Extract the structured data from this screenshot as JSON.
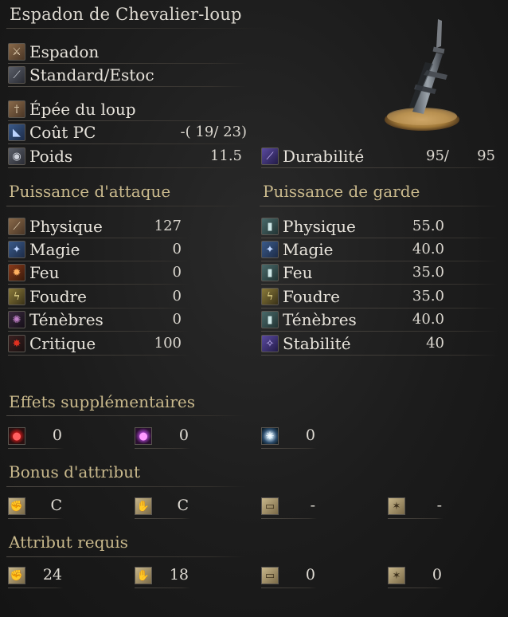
{
  "title": "Espadon de Chevalier-loup",
  "weapon": {
    "category": "Espadon",
    "attack_type": "Standard/Estoc",
    "skill": "Épée du loup",
    "fp_cost_label": "Coût PC",
    "fp_cost_value": "-( 19/ 23)",
    "weight_label": "Poids",
    "weight_value": "11.5",
    "durability_label": "Durabilité",
    "durability_current": "95/",
    "durability_max": "95"
  },
  "attack": {
    "heading": "Puissance d'attaque",
    "rows": [
      {
        "label": "Physique",
        "value": "127",
        "icon": "physical-icon"
      },
      {
        "label": "Magie",
        "value": "0",
        "icon": "magic-icon"
      },
      {
        "label": "Feu",
        "value": "0",
        "icon": "fire-icon"
      },
      {
        "label": "Foudre",
        "value": "0",
        "icon": "lightning-icon"
      },
      {
        "label": "Ténèbres",
        "value": "0",
        "icon": "dark-icon"
      },
      {
        "label": "Critique",
        "value": "100",
        "icon": "critical-icon"
      }
    ]
  },
  "guard": {
    "heading": "Puissance de garde",
    "rows": [
      {
        "label": "Physique",
        "value": "55.0",
        "icon": "physical-guard-icon"
      },
      {
        "label": "Magie",
        "value": "40.0",
        "icon": "magic-guard-icon"
      },
      {
        "label": "Feu",
        "value": "35.0",
        "icon": "fire-guard-icon"
      },
      {
        "label": "Foudre",
        "value": "35.0",
        "icon": "lightning-guard-icon"
      },
      {
        "label": "Ténèbres",
        "value": "40.0",
        "icon": "dark-guard-icon"
      },
      {
        "label": "Stabilité",
        "value": "40",
        "icon": "stability-icon"
      }
    ]
  },
  "effects": {
    "heading": "Effets supplémentaires",
    "items": [
      {
        "icon": "bleed-icon",
        "value": "0"
      },
      {
        "icon": "poison-icon",
        "value": "0"
      },
      {
        "icon": "frost-icon",
        "value": "0"
      }
    ]
  },
  "scaling": {
    "heading": "Bonus d'attribut",
    "items": [
      {
        "icon": "strength-icon",
        "value": "C"
      },
      {
        "icon": "dexterity-icon",
        "value": "C"
      },
      {
        "icon": "intelligence-icon",
        "value": "-"
      },
      {
        "icon": "faith-icon",
        "value": "-"
      }
    ]
  },
  "requirements": {
    "heading": "Attribut requis",
    "items": [
      {
        "icon": "strength-icon",
        "value": "24"
      },
      {
        "icon": "dexterity-icon",
        "value": "18"
      },
      {
        "icon": "intelligence-icon",
        "value": "0"
      },
      {
        "icon": "faith-icon",
        "value": "0"
      }
    ]
  }
}
